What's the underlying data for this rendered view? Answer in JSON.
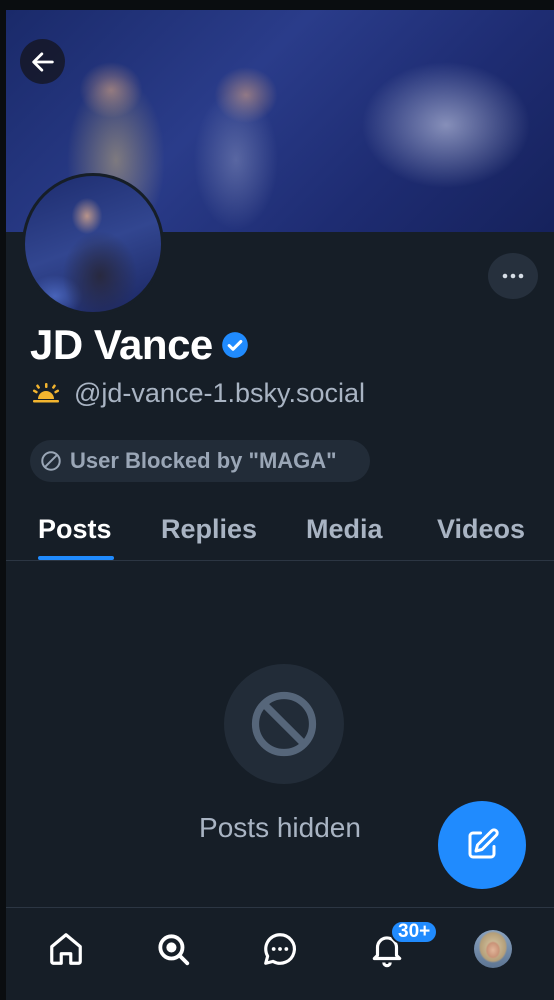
{
  "profile": {
    "name": "JD Vance",
    "handle": "@jd-vance-1.bsky.social",
    "blocked_label": "User Blocked by \"MAGA\""
  },
  "tabs": [
    {
      "label": "Posts",
      "active": true
    },
    {
      "label": "Replies",
      "active": false
    },
    {
      "label": "Media",
      "active": false
    },
    {
      "label": "Videos",
      "active": false
    }
  ],
  "content": {
    "hidden_label": "Posts hidden"
  },
  "bottom_nav": {
    "items": [
      "home-icon",
      "search-icon",
      "chat-icon",
      "bell-icon",
      "profile-avatar"
    ],
    "notification_badge": "30+"
  },
  "colors": {
    "background": "#161e27",
    "accent": "#208bfe",
    "muted_text": "#a9b4c3"
  }
}
